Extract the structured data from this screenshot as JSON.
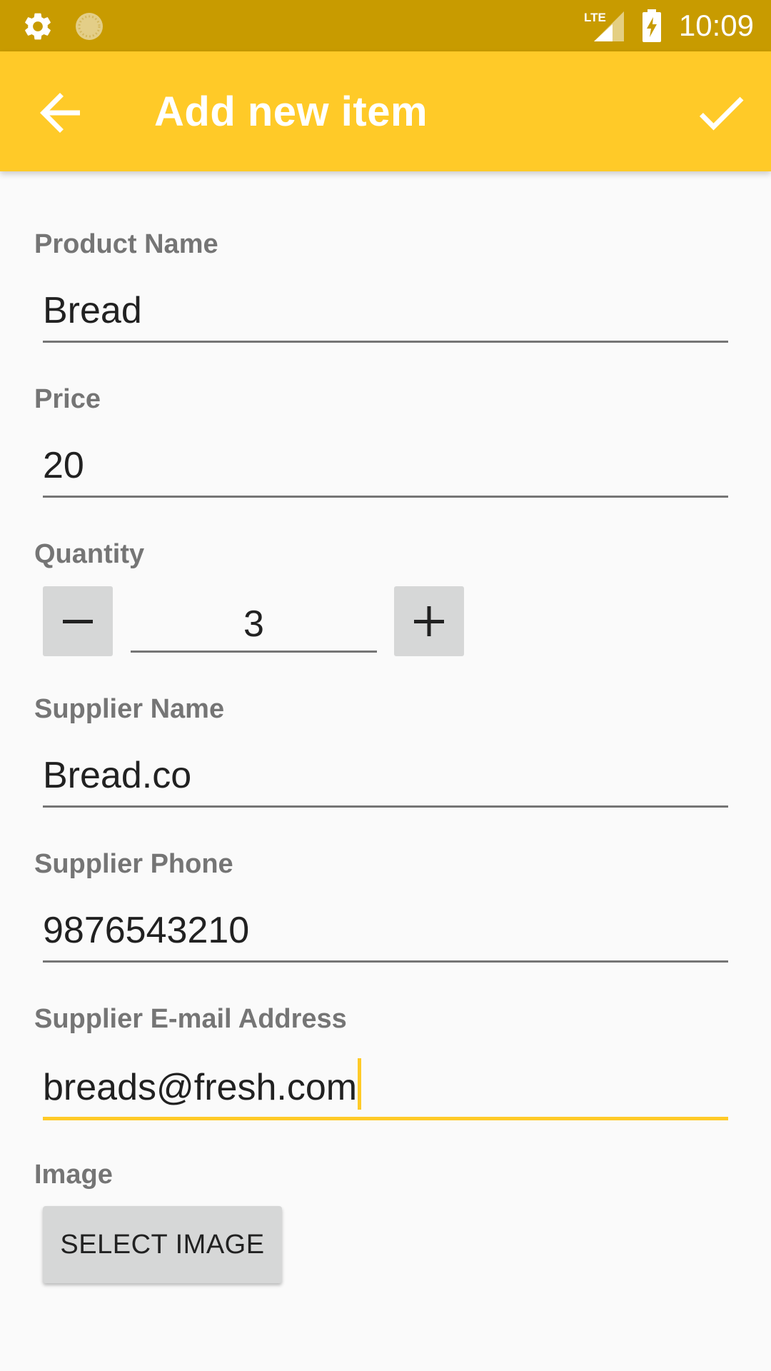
{
  "status_bar": {
    "time": "10:09",
    "network": "LTE",
    "icons": [
      "settings-icon",
      "loading-icon",
      "lte-signal-icon",
      "battery-charging-icon"
    ]
  },
  "toolbar": {
    "title": "Add new item",
    "back_icon": "arrow-back-icon",
    "save_icon": "check-icon",
    "color": "#ffca28"
  },
  "form": {
    "product_name": {
      "label": "Product Name",
      "value": "Bread"
    },
    "price": {
      "label": "Price",
      "value": "20"
    },
    "quantity": {
      "label": "Quantity",
      "value": "3",
      "decrement_icon": "minus-icon",
      "increment_icon": "plus-icon"
    },
    "supplier_name": {
      "label": "Supplier Name",
      "value": "Bread.co"
    },
    "supplier_phone": {
      "label": "Supplier Phone",
      "value": "9876543210"
    },
    "supplier_email": {
      "label": "Supplier E-mail Address",
      "value": "breads@fresh.com"
    },
    "image": {
      "label": "Image",
      "button_label": "SELECT IMAGE"
    }
  },
  "colors": {
    "status_bar": "#c89b00",
    "accent": "#ffca28",
    "label": "#757575"
  }
}
